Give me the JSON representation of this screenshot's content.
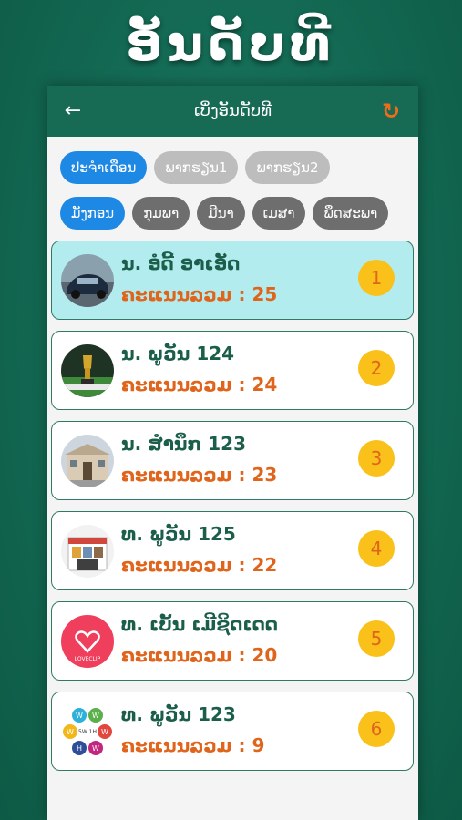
{
  "banner": {
    "title": "ອັນດັບທີ"
  },
  "appbar": {
    "back_icon": "arrow-left-icon",
    "title": "ເບິ່ງອັນດັບທີ",
    "refresh_icon": "refresh-icon"
  },
  "filters": {
    "row1": [
      {
        "label": "ປະຈຳເດືອນ",
        "active": true
      },
      {
        "label": "ພາກຮຽນ1",
        "active": false
      },
      {
        "label": "ພາກຮຽນ2",
        "active": false
      }
    ],
    "row2": [
      {
        "label": "ມັງກອນ",
        "active": true
      },
      {
        "label": "ກຸມພາ",
        "active": false
      },
      {
        "label": "ມີນາ",
        "active": false
      },
      {
        "label": "ເມສາ",
        "active": false
      },
      {
        "label": "ພຶດສະພາ",
        "active": false
      }
    ]
  },
  "score_label": "ຄະແນນລວມ :",
  "rankings": [
    {
      "name": "ນ. ອໍດີ້ ອາເອັດ",
      "score": "25",
      "rank": "1",
      "avatar": "car-photo"
    },
    {
      "name": "ນ. ພູວັນ 124",
      "score": "24",
      "rank": "2",
      "avatar": "trophy-photo"
    },
    {
      "name": "ນ. ສຳນຶກ 123",
      "score": "23",
      "rank": "3",
      "avatar": "building-photo"
    },
    {
      "name": "ທ. ພູວັນ 125",
      "score": "22",
      "rank": "4",
      "avatar": "shop-photo"
    },
    {
      "name": "ທ. ເບັ້ນ ເມີຊິດເດດ",
      "score": "20",
      "rank": "5",
      "avatar": "heart-logo"
    },
    {
      "name": "ທ. ພູວັນ 123",
      "score": "9",
      "rank": "6",
      "avatar": "5w1h-logo"
    }
  ],
  "colors": {
    "primary": "#176b55",
    "accent": "#e0651c",
    "chip_active": "#1e88e5",
    "rank_badge": "#f9c11a",
    "first_card": "#b2ecef"
  },
  "avatar_texts": {
    "heart_logo": "LOVECLIP",
    "w": "W",
    "h": "H",
    "center": "5W 1H"
  }
}
